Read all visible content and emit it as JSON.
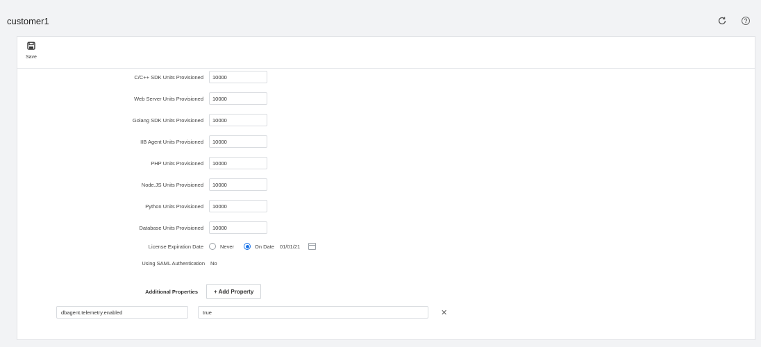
{
  "header": {
    "title": "customer1",
    "icons": [
      "refresh-icon",
      "help-icon"
    ]
  },
  "toolbar": {
    "save_label": "Save",
    "save_icon": "floppy-disk-icon"
  },
  "fields": [
    {
      "label": "C/C++ SDK Units Provisioned",
      "value": "10000"
    },
    {
      "label": "Web Server Units Provisioned",
      "value": "10000"
    },
    {
      "label": "Golang SDK Units Provisioned",
      "value": "10000"
    },
    {
      "label": "IIB Agent Units Provisioned",
      "value": "10000"
    },
    {
      "label": "PHP Units Provisioned",
      "value": "10000"
    },
    {
      "label": "Node.JS Units Provisioned",
      "value": "10000"
    },
    {
      "label": "Python Units Provisioned",
      "value": "10000"
    },
    {
      "label": "Database Units Provisioned",
      "value": "10000"
    }
  ],
  "license": {
    "label": "License Expiration Date",
    "options": [
      "Never",
      "On Date"
    ],
    "selected": "On Date",
    "date": "01/01/21"
  },
  "saml": {
    "label": "Using SAML Authentication",
    "value": "No"
  },
  "additional": {
    "header": "Additional Properties",
    "add_button": "+ Add Property",
    "properties": [
      {
        "key": "dbagent.telemetry.enabled",
        "value": "true"
      }
    ]
  },
  "colors": {
    "accent": "#1a73e8",
    "background": "#f2f3f5"
  }
}
